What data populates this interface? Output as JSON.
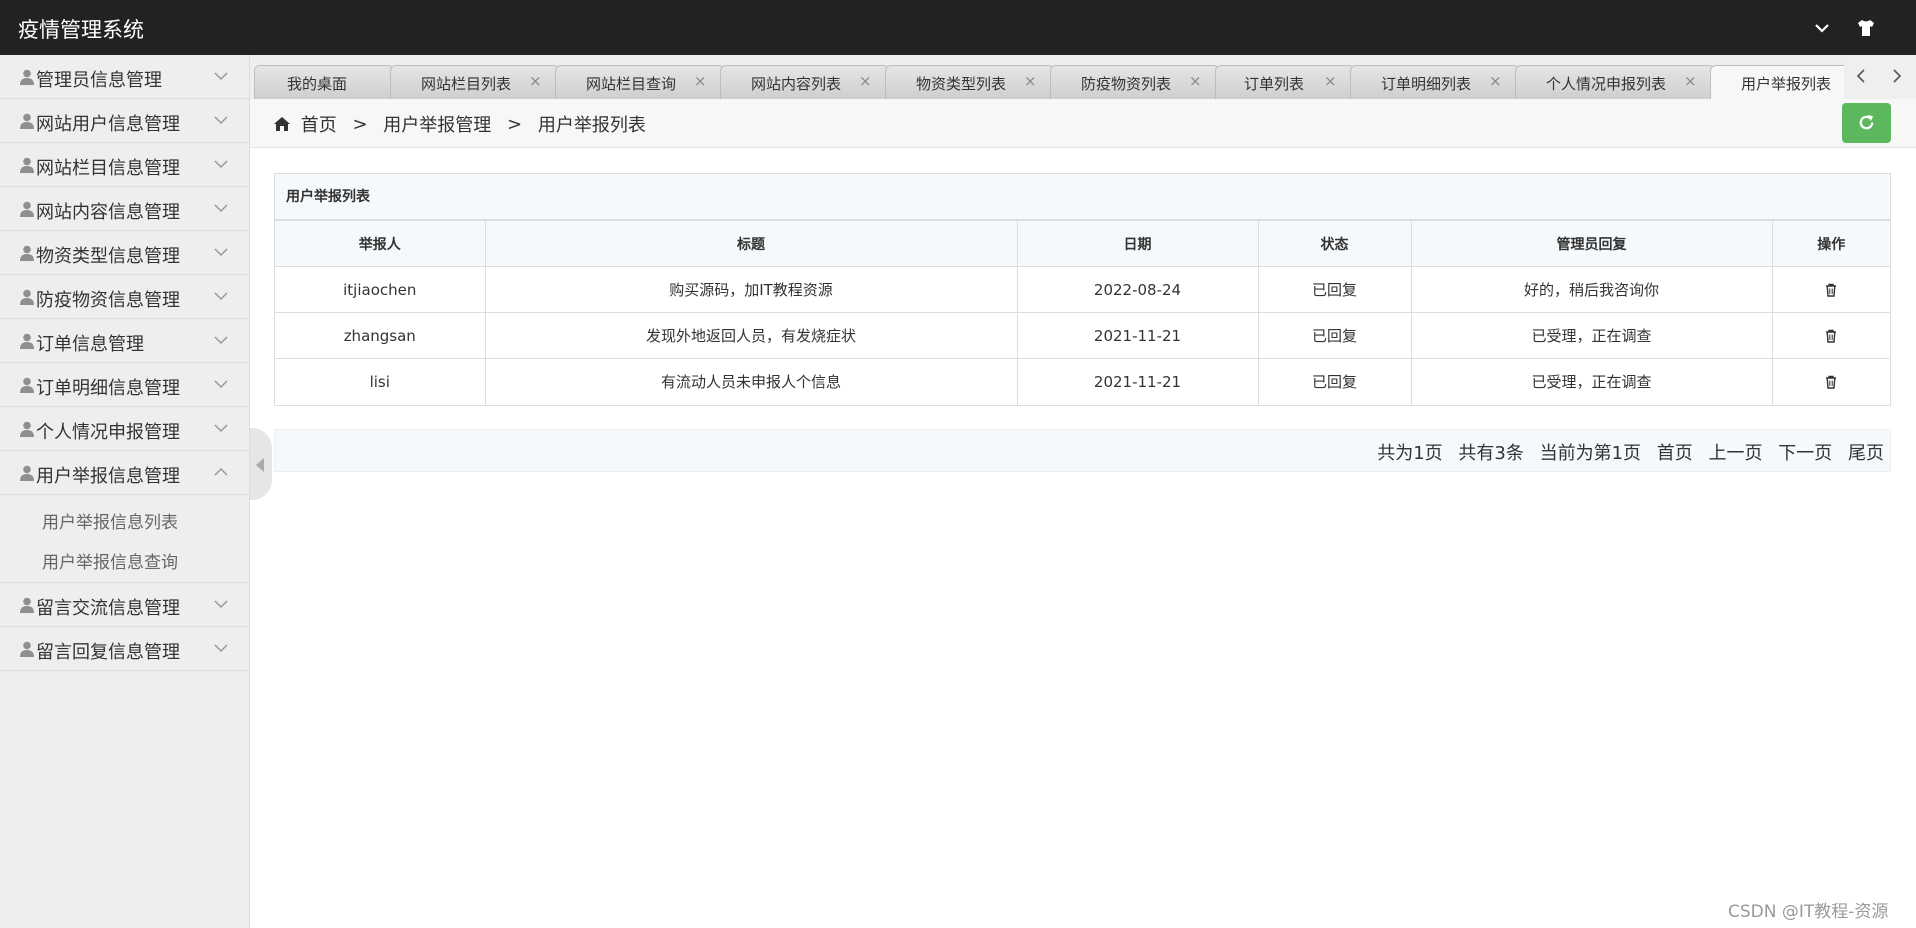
{
  "app": {
    "title": "疫情管理系统"
  },
  "header": {
    "icons": [
      "chevron-down-icon",
      "shirt-icon"
    ]
  },
  "sidebar": {
    "items": [
      {
        "label": "管理员信息管理",
        "expanded": false
      },
      {
        "label": "网站用户信息管理",
        "expanded": false
      },
      {
        "label": "网站栏目信息管理",
        "expanded": false
      },
      {
        "label": "网站内容信息管理",
        "expanded": false
      },
      {
        "label": "物资类型信息管理",
        "expanded": false
      },
      {
        "label": "防疫物资信息管理",
        "expanded": false
      },
      {
        "label": "订单信息管理",
        "expanded": false
      },
      {
        "label": "订单明细信息管理",
        "expanded": false
      },
      {
        "label": "个人情况申报管理",
        "expanded": false
      },
      {
        "label": "用户举报信息管理",
        "expanded": true
      },
      {
        "label": "留言交流信息管理",
        "expanded": false
      },
      {
        "label": "留言回复信息管理",
        "expanded": false
      }
    ],
    "submenu": [
      "用户举报信息列表",
      "用户举报信息查询"
    ]
  },
  "tabs": [
    {
      "label": "我的桌面",
      "closable": false
    },
    {
      "label": "网站栏目列表",
      "closable": true
    },
    {
      "label": "网站栏目查询",
      "closable": true
    },
    {
      "label": "网站内容列表",
      "closable": true
    },
    {
      "label": "物资类型列表",
      "closable": true
    },
    {
      "label": "防疫物资列表",
      "closable": true
    },
    {
      "label": "订单列表",
      "closable": true
    },
    {
      "label": "订单明细列表",
      "closable": true
    },
    {
      "label": "个人情况申报列表",
      "closable": true
    },
    {
      "label": "用户举报列表",
      "closable": false,
      "active": true
    }
  ],
  "breadcrumb": {
    "home": "首页",
    "level1": "用户举报管理",
    "level2": "用户举报列表",
    "separator": ">"
  },
  "panel": {
    "title": "用户举报列表",
    "columns": [
      "举报人",
      "标题",
      "日期",
      "状态",
      "管理员回复",
      "操作"
    ],
    "rows": [
      [
        "itjiaochen",
        "购买源码，加IT教程资源",
        "2022-08-24",
        "已回复",
        "好的，稍后我咨询你"
      ],
      [
        "zhangsan",
        "发现外地返回人员，有发烧症状",
        "2021-11-21",
        "已回复",
        "已受理，正在调查"
      ],
      [
        "lisi",
        "有流动人员未申报人个信息",
        "2021-11-21",
        "已回复",
        "已受理，正在调查"
      ]
    ]
  },
  "pager": {
    "total_pages": "共为1页",
    "total_records": "共有3条",
    "current": "当前为第1页",
    "first": "首页",
    "prev": "上一页",
    "next": "下一页",
    "last": "尾页"
  },
  "watermark": "CSDN @IT教程-资源",
  "colors": {
    "topbar": "#222222",
    "sidebar": "#eeeeee",
    "refresh_button": "#5cb85c",
    "table_header": "#f5f9fc"
  }
}
